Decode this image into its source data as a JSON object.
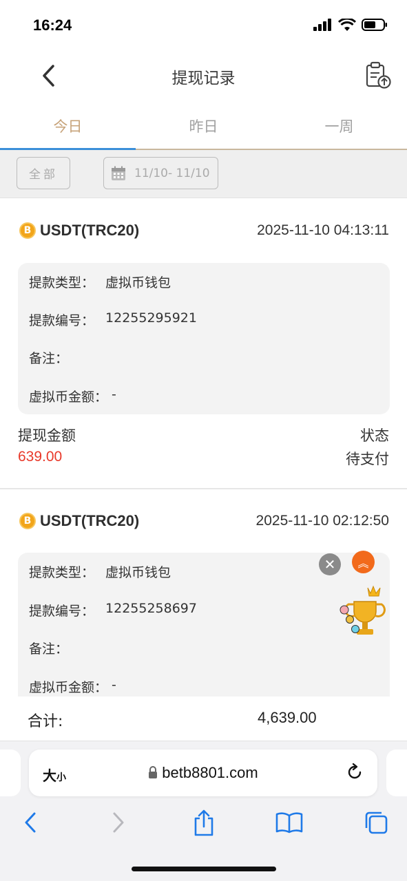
{
  "status_bar": {
    "time": "16:24"
  },
  "nav": {
    "title": "提现记录",
    "back_icon": "chevron-left-icon",
    "action_icon": "clipboard-upload-icon"
  },
  "tabs": [
    {
      "label": "今日",
      "active": true
    },
    {
      "label": "昨日",
      "active": false
    },
    {
      "label": "一周",
      "active": false
    }
  ],
  "filters": {
    "all_label": "全部",
    "date_range": "11/10- 11/10"
  },
  "records": [
    {
      "currency": "USDT(TRC20)",
      "coin_symbol": "B",
      "time": "2025-11-10 04:13:11",
      "type_label": "提款类型：",
      "type_value": "虚拟币钱包",
      "id_label": "提款编号：",
      "id_value": "12255295921",
      "note_label": "备注：",
      "note_value": "",
      "crypto_label": "虚拟币金额：",
      "crypto_value": "-",
      "amount_label": "提现金额",
      "amount_value": "639.00",
      "status_label": "状态",
      "status_value": "待支付"
    },
    {
      "currency": "USDT(TRC20)",
      "coin_symbol": "B",
      "time": "2025-11-10 02:12:50",
      "type_label": "提款类型：",
      "type_value": "虚拟币钱包",
      "id_label": "提款编号：",
      "id_value": "12255258697",
      "note_label": "备注：",
      "note_value": "",
      "crypto_label": "虚拟币金额：",
      "crypto_value": "-"
    }
  ],
  "total": {
    "label": "合计:",
    "value": "4,639.00"
  },
  "floating": {
    "close_glyph": "✕",
    "up_glyph": "︽"
  },
  "browser": {
    "text_size_label": "大",
    "text_size_small": "小",
    "url": "betb8801.com"
  },
  "colors": {
    "accent_tab": "#c7a37a",
    "tab_underline": "#3b8fd9",
    "amount": "#e8392a",
    "browser_blue": "#1f7ae8"
  }
}
